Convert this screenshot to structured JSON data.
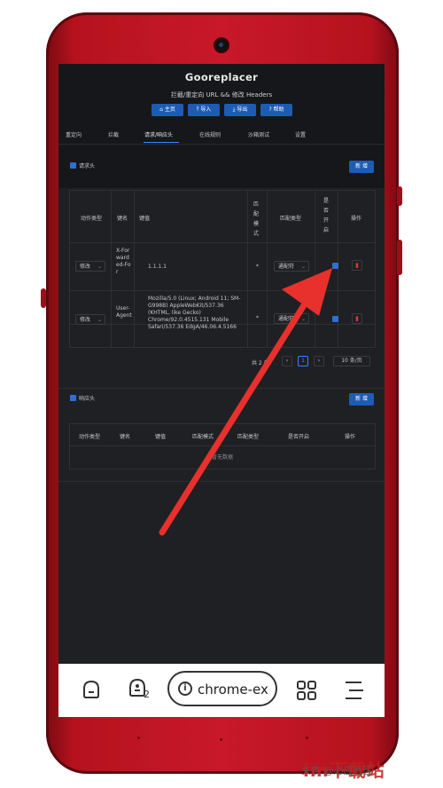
{
  "app": {
    "title": "Gooreplacer",
    "subtitle": "拦截/重定向 URL && 修改 Headers",
    "buttons": [
      {
        "icon": "home-icon",
        "label": "⌂ 主页"
      },
      {
        "icon": "upload-icon",
        "label": "⤒ 导入"
      },
      {
        "icon": "download-icon",
        "label": "⤓ 导出"
      },
      {
        "icon": "help-icon",
        "label": "? 帮助"
      }
    ]
  },
  "tabs": [
    "重定向",
    "拦截",
    "请求/响应头",
    "在线规则",
    "沙箱测试",
    "设置"
  ],
  "request_section": {
    "label": "请求头",
    "new_button": "新 增",
    "columns": [
      "动作类型",
      "键名",
      "键值",
      "匹配模式",
      "匹配类型",
      "是否开启",
      "操作"
    ],
    "rows": [
      {
        "action": "修改",
        "key": "X-Forwarded-For",
        "value": "1.1.1.1",
        "pattern": "*",
        "match_type": "通配符",
        "enabled": true
      },
      {
        "action": "修改",
        "key": "User-Agent",
        "value": "Mozilla/5.0 (Linux; Android 11; SM-G998B) AppleWebKit/537.36 (KHTML, like Gecko) Chrome/92.0.4515.131 Mobile Safari/537.36 EdgA/46.06.4.5166",
        "pattern": "*",
        "match_type": "通配符",
        "enabled": true
      }
    ],
    "pagination": {
      "total_text": "共 2 条",
      "current_page": "1",
      "page_size": "10 条/页"
    }
  },
  "response_section": {
    "label": "响应头",
    "new_button": "新 增",
    "columns": [
      "动作类型",
      "键名",
      "键值",
      "匹配模式",
      "匹配类型",
      "是否开启",
      "操作"
    ],
    "empty_text": "暂无数据"
  },
  "navbar": {
    "url_text": "chrome-ex",
    "tab_count": "2"
  },
  "watermark": "头条 @必应社区",
  "colors": {
    "accent": "#1e5cb3",
    "danger": "#d23b3b",
    "phone": "#c8182a",
    "arrow": "#e8302d"
  }
}
